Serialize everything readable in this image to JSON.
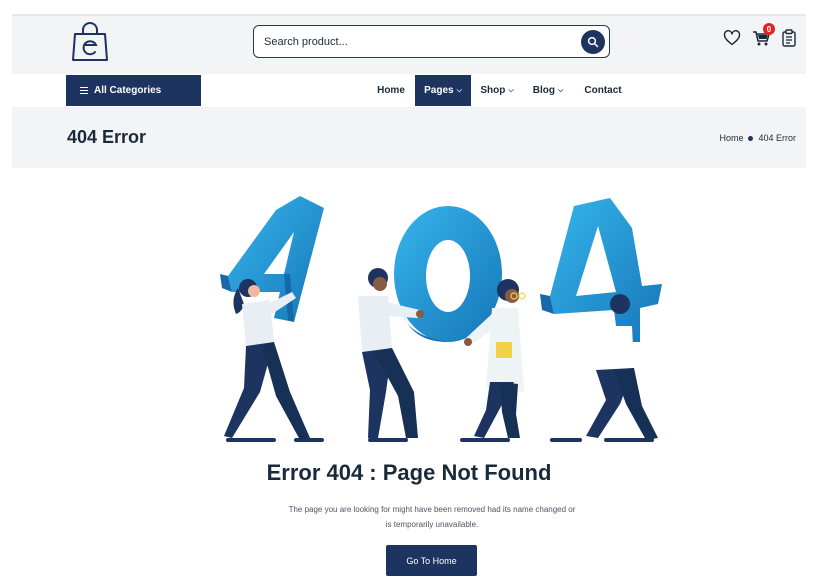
{
  "header": {
    "search": {
      "placeholder": "Search product..."
    },
    "cart": {
      "count": "0"
    }
  },
  "nav": {
    "all_categories": "All Categories",
    "items": [
      {
        "label": "Home",
        "active": false
      },
      {
        "label": "Pages",
        "active": true
      },
      {
        "label": "Shop",
        "active": false
      },
      {
        "label": "Blog",
        "active": false
      },
      {
        "label": "Contact",
        "active": false
      }
    ]
  },
  "title_band": {
    "title": "404 Error",
    "breadcrumb": {
      "home": "Home",
      "current": "404 Error"
    }
  },
  "content": {
    "error_title": "Error 404 : Page Not Found",
    "message_line1": "The page you are looking for might have been removed had its name changed or",
    "message_line2": "is temporarily unavailable.",
    "button": "Go To Home"
  },
  "icons": [
    "shopping-bag-logo-icon",
    "search-icon",
    "heart-icon",
    "cart-icon",
    "clipboard-icon"
  ],
  "colors": {
    "brand_navy": "#1d3461",
    "illustration_blue": "#1f8fd1",
    "illustration_light": "#35b2ea",
    "badge_red": "#e02424"
  }
}
